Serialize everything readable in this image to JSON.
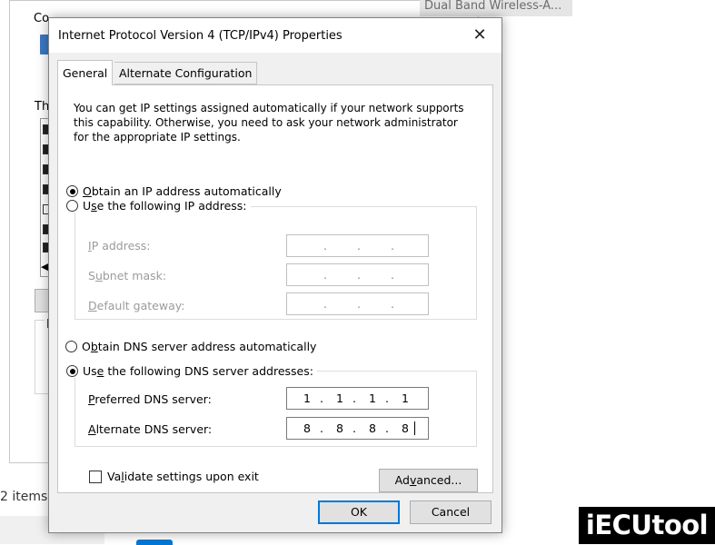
{
  "background": {
    "adapter_name": "Dual Band Wireless-A...",
    "connect_using_label": "Co",
    "this_connection_label": "Th",
    "partial_label": "D",
    "items_count": "2 items"
  },
  "dialog": {
    "title": "Internet Protocol Version 4 (TCP/IPv4) Properties",
    "close_glyph": "✕",
    "tabs": [
      {
        "label": "General"
      },
      {
        "label": "Alternate Configuration"
      }
    ],
    "description": "You can get IP settings assigned automatically if your network supports this capability. Otherwise, you need to ask your network administrator for the appropriate IP settings.",
    "ip_section": {
      "auto_radio": {
        "pre": "",
        "key": "O",
        "post": "btain an IP address automatically",
        "selected": true
      },
      "manual_radio": {
        "pre": "U",
        "key": "s",
        "post": "e the following IP address:",
        "selected": false
      },
      "fields": [
        {
          "pre": "",
          "key": "I",
          "post": "P address:",
          "octets": [
            "",
            "",
            "",
            ""
          ],
          "enabled": false
        },
        {
          "pre": "S",
          "key": "u",
          "post": "bnet mask:",
          "octets": [
            "",
            "",
            "",
            ""
          ],
          "enabled": false
        },
        {
          "pre": "",
          "key": "D",
          "post": "efault gateway:",
          "octets": [
            "",
            "",
            "",
            ""
          ],
          "enabled": false
        }
      ]
    },
    "dns_section": {
      "auto_radio": {
        "pre": "O",
        "key": "b",
        "post": "tain DNS server address automatically",
        "selected": false
      },
      "manual_radio": {
        "pre": "Us",
        "key": "e",
        "post": " the following DNS server addresses:",
        "selected": true
      },
      "fields": [
        {
          "pre": "",
          "key": "P",
          "post": "referred DNS server:",
          "octets": [
            "1",
            "1",
            "1",
            "1"
          ],
          "enabled": true
        },
        {
          "pre": "",
          "key": "A",
          "post": "lternate DNS server:",
          "octets": [
            "8",
            "8",
            "8",
            "8"
          ],
          "enabled": true
        }
      ]
    },
    "validate_checkbox": {
      "pre": "Va",
      "key": "l",
      "post": "idate settings upon exit",
      "checked": false
    },
    "advanced_button": {
      "pre": "Ad",
      "key": "v",
      "post": "anced..."
    },
    "ok_button": "OK",
    "cancel_button": "Cancel"
  },
  "watermark": "iECUtool",
  "colors": {
    "dialog_bg": "#f0f0f0",
    "focus_border": "#0078d7",
    "disabled_text": "#9b9b9b"
  }
}
